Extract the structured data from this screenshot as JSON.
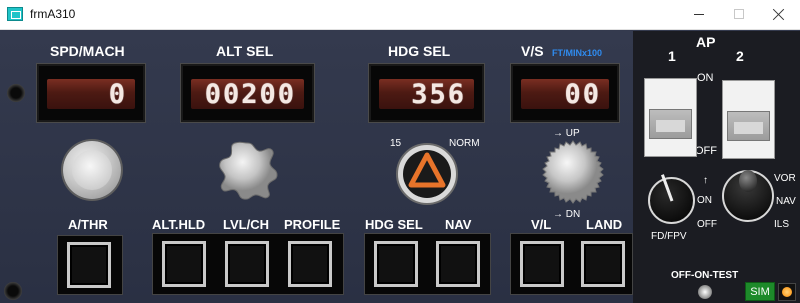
{
  "window": {
    "title": "frmA310",
    "icons": {
      "app": "app-icon",
      "minimize": "minimize-icon",
      "maximize": "maximize-icon",
      "close": "close-icon"
    }
  },
  "labels": {
    "spd_mach": "SPD/MACH",
    "alt_sel": "ALT SEL",
    "hdg_sel_top": "HDG SEL",
    "vs": "V/S",
    "vs_unit": "FT/MINx100",
    "ap": "AP",
    "ap_1": "1",
    "ap_2": "2",
    "ap_on": "ON",
    "ap_off": "OFF",
    "hdg_15": "15",
    "hdg_norm": "NORM",
    "vs_up": "→ UP",
    "vs_dn": "→ DN",
    "fd_arrow": "↑",
    "fd_on": "ON",
    "fd_off": "OFF",
    "fd_fpv": "FD/FPV",
    "vor": "VOR",
    "nav_mode": "NAV",
    "ils": "ILS",
    "off_on_test": "OFF-ON-TEST",
    "sim": "SIM"
  },
  "displays": {
    "spd_mach": "0",
    "alt_sel": "00200",
    "hdg_sel": "356",
    "vs": "00"
  },
  "buttons": {
    "athr": "A/THR",
    "alt_hld": "ALT.HLD",
    "lvl_ch": "LVL/CH",
    "profile": "PROFILE",
    "hdg_sel": "HDG SEL",
    "nav": "NAV",
    "vl": "V/L",
    "land": "LAND"
  },
  "colors": {
    "panel": "#2d3346",
    "display_glass": "#4d1a13",
    "display_digits": "#f4e8e3",
    "unit_label": "#2f8cf0",
    "sim_badge": "#1d8a2a",
    "indicator_lamp": "#ff8c00",
    "hdg_triangle": "#e8742a"
  }
}
